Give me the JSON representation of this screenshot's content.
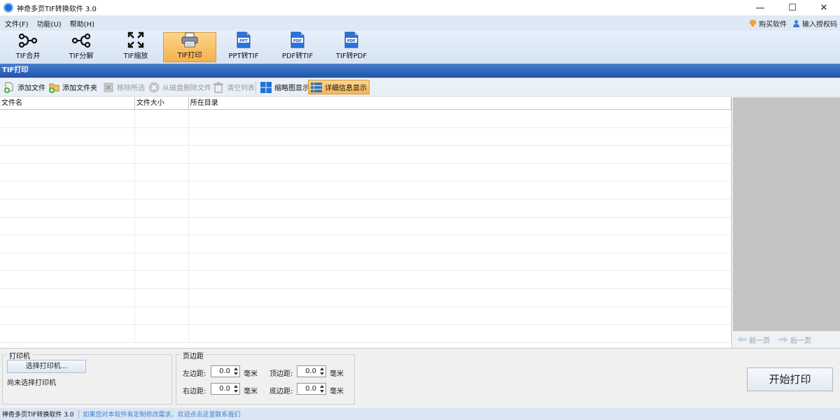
{
  "window": {
    "title": "神奇多页TIF转换软件 3.0",
    "controls": [
      "—",
      "☐",
      "✕"
    ]
  },
  "menubar": {
    "items": [
      "文件(F)",
      "功能(U)",
      "帮助(H)"
    ],
    "buy_label": "购买软件",
    "license_label": "输入授权码"
  },
  "toolbar": {
    "tools": [
      {
        "label": "TIF合并",
        "icon": "merge-icon"
      },
      {
        "label": "TIF分解",
        "icon": "split-icon"
      },
      {
        "label": "TIF缩放",
        "icon": "resize-icon"
      },
      {
        "label": "TIF打印",
        "icon": "printer-icon",
        "active": true
      },
      {
        "label": "PPT转TIF",
        "icon": "ppt-file-icon",
        "badge": "PPT"
      },
      {
        "label": "PDF转TIF",
        "icon": "pdf-file-icon",
        "badge": "PDF"
      },
      {
        "label": "TIF转PDF",
        "icon": "pdf-file-icon",
        "badge": "PDF"
      }
    ]
  },
  "section": {
    "title": "TIF打印"
  },
  "actions": {
    "add_file": "添加文件",
    "add_folder": "添加文件夹",
    "remove_selected": "移除所选",
    "delete_from_disk": "从磁盘删除文件",
    "clear_list": "清空列表",
    "thumbnail_view": "缩略图显示",
    "detail_view": "详细信息显示"
  },
  "table": {
    "columns": [
      "文件名",
      "文件大小",
      "所在目录"
    ],
    "rows": []
  },
  "preview": {
    "prev_label": "前一页",
    "next_label": "后一页"
  },
  "printer": {
    "group_title": "打印机",
    "select_button": "选择打印机...",
    "status": "尚未选择打印机"
  },
  "margins": {
    "group_title": "页边距",
    "left_label": "左边距:",
    "left_value": "0.0",
    "top_label": "顶边距:",
    "top_value": "0.0",
    "right_label": "右边距:",
    "right_value": "0.0",
    "bottom_label": "底边距:",
    "bottom_value": "0.0",
    "unit": "毫米"
  },
  "start_button": "开始打印",
  "statusbar": {
    "app_name": "神奇多页TIF转换软件 3.0",
    "message": "如果您对本软件有定制修改需求，欢迎点击这里联系我们"
  },
  "colors": {
    "accent": "#2052a8",
    "active_tool": "#f6b14c",
    "status_link": "#3f7fd6"
  }
}
